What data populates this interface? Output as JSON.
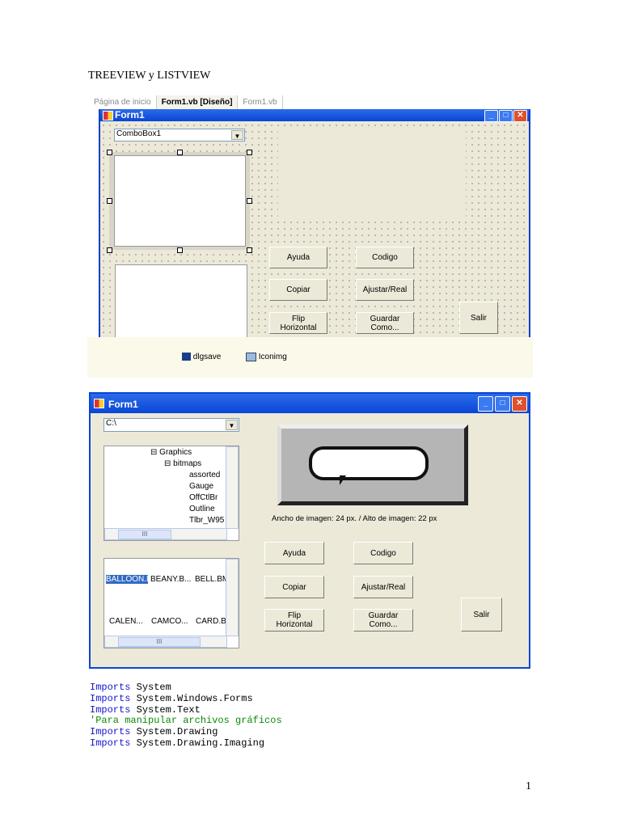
{
  "doc_title": "TREEVIEW y LISTVIEW",
  "page_number": "1",
  "designer": {
    "tabs": [
      "Página de inicio",
      "Form1.vb [Diseño]",
      "Form1.vb"
    ],
    "form_title": "Form1",
    "combo": "ComboBox1",
    "buttons": {
      "ayuda": "Ayuda",
      "codigo": "Codigo",
      "copiar": "Copiar",
      "ajustar": "Ajustar/Real",
      "flip": "Flip\nHorizontal",
      "guardar": "Guardar\nComo...",
      "salir": "Salir"
    },
    "tray": [
      "dlgsave",
      "Iconimg"
    ]
  },
  "runtime": {
    "form_title": "Form1",
    "combo": "C:\\",
    "tree": [
      "Graphics",
      "bitmaps",
      "assorted",
      "Gauge",
      "OffCtlBr",
      "Outline",
      "Tlbr_W95"
    ],
    "list": [
      "BALLOON.BMP",
      "BEANY.B...",
      "BELL.BM",
      "CALEN...",
      "CAMCO...",
      "CARD.B"
    ],
    "image_info": "Ancho de imagen: 24 px.  /  Alto de imagen: 22 px",
    "buttons": {
      "ayuda": "Ayuda",
      "codigo": "Codigo",
      "copiar": "Copiar",
      "ajustar": "Ajustar/Real",
      "flip": "Flip\nHorizontal",
      "guardar": "Guardar\nComo...",
      "salir": "Salir"
    }
  },
  "code": [
    {
      "kw": "Imports",
      "rest": " System"
    },
    {
      "kw": "Imports",
      "rest": " System.Windows.Forms"
    },
    {
      "kw": "Imports",
      "rest": " System.Text"
    },
    {
      "comment": "'Para manipular archivos gráficos"
    },
    {
      "kw": "Imports",
      "rest": " System.Drawing"
    },
    {
      "kw": "Imports",
      "rest": " System.Drawing.Imaging"
    }
  ]
}
